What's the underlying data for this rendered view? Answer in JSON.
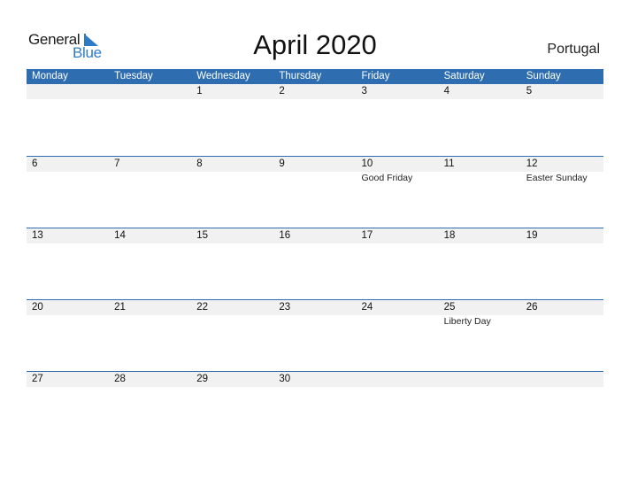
{
  "logo": {
    "word1": "General",
    "word2": "Blue",
    "accent": "#2e7cc6"
  },
  "title": "April 2020",
  "country": "Portugal",
  "colors": {
    "header_bg": "#2e6eb0",
    "strip_bg": "#f1f1f1"
  },
  "weekdays": [
    "Monday",
    "Tuesday",
    "Wednesday",
    "Thursday",
    "Friday",
    "Saturday",
    "Sunday"
  ],
  "weeks": [
    {
      "days": [
        {
          "num": "",
          "holiday": ""
        },
        {
          "num": "",
          "holiday": ""
        },
        {
          "num": "1",
          "holiday": ""
        },
        {
          "num": "2",
          "holiday": ""
        },
        {
          "num": "3",
          "holiday": ""
        },
        {
          "num": "4",
          "holiday": ""
        },
        {
          "num": "5",
          "holiday": ""
        }
      ]
    },
    {
      "days": [
        {
          "num": "6",
          "holiday": ""
        },
        {
          "num": "7",
          "holiday": ""
        },
        {
          "num": "8",
          "holiday": ""
        },
        {
          "num": "9",
          "holiday": ""
        },
        {
          "num": "10",
          "holiday": "Good Friday"
        },
        {
          "num": "11",
          "holiday": ""
        },
        {
          "num": "12",
          "holiday": "Easter Sunday"
        }
      ]
    },
    {
      "days": [
        {
          "num": "13",
          "holiday": ""
        },
        {
          "num": "14",
          "holiday": ""
        },
        {
          "num": "15",
          "holiday": ""
        },
        {
          "num": "16",
          "holiday": ""
        },
        {
          "num": "17",
          "holiday": ""
        },
        {
          "num": "18",
          "holiday": ""
        },
        {
          "num": "19",
          "holiday": ""
        }
      ]
    },
    {
      "days": [
        {
          "num": "20",
          "holiday": ""
        },
        {
          "num": "21",
          "holiday": ""
        },
        {
          "num": "22",
          "holiday": ""
        },
        {
          "num": "23",
          "holiday": ""
        },
        {
          "num": "24",
          "holiday": ""
        },
        {
          "num": "25",
          "holiday": "Liberty Day"
        },
        {
          "num": "26",
          "holiday": ""
        }
      ]
    },
    {
      "days": [
        {
          "num": "27",
          "holiday": ""
        },
        {
          "num": "28",
          "holiday": ""
        },
        {
          "num": "29",
          "holiday": ""
        },
        {
          "num": "30",
          "holiday": ""
        },
        {
          "num": "",
          "holiday": ""
        },
        {
          "num": "",
          "holiday": ""
        },
        {
          "num": "",
          "holiday": ""
        }
      ]
    }
  ]
}
